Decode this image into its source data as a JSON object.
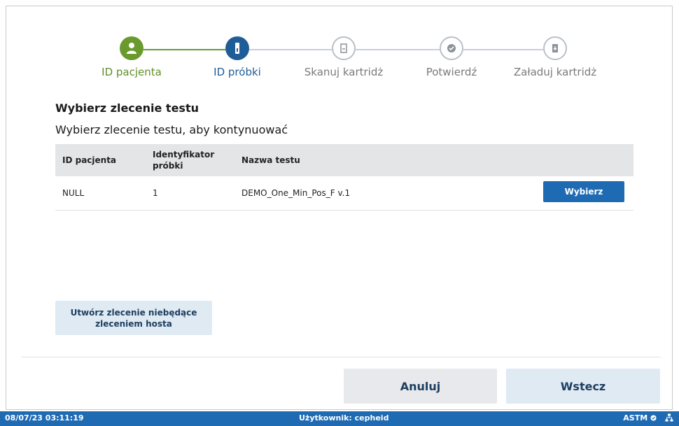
{
  "stepper": {
    "steps": [
      {
        "label": "ID pacjenta",
        "state": "done",
        "icon": "person-icon"
      },
      {
        "label": "ID próbki",
        "state": "active",
        "icon": "sample-tube-icon"
      },
      {
        "label": "Skanuj kartridż",
        "state": "todo",
        "icon": "cartridge-scan-icon"
      },
      {
        "label": "Potwierdź",
        "state": "todo",
        "icon": "check-icon"
      },
      {
        "label": "Załaduj kartridż",
        "state": "todo",
        "icon": "cartridge-load-icon"
      }
    ]
  },
  "content": {
    "heading": "Wybierz zlecenie testu",
    "subheading": "Wybierz zlecenie testu, aby kontynuować"
  },
  "table": {
    "headers": [
      "ID pacjenta",
      "Identyfikator próbki",
      "Nazwa testu"
    ],
    "rows": [
      {
        "patient_id": "NULL",
        "sample_id": "1",
        "test_name": "DEMO_One_Min_Pos_F v.1",
        "action_label": "Wybierz"
      }
    ]
  },
  "actions": {
    "create_nonhost": "Utwórz zlecenie niebędące zleceniem hosta",
    "cancel": "Anuluj",
    "back": "Wstecz"
  },
  "status": {
    "datetime": "08/07/23 03:11:19",
    "user": "Użytkownik: cepheid",
    "protocol": "ASTM"
  },
  "colors": {
    "done": "#6a9a2e",
    "active": "#1f5d98",
    "primary_button": "#1f6bb3",
    "status_bar": "#1f6bb3"
  }
}
